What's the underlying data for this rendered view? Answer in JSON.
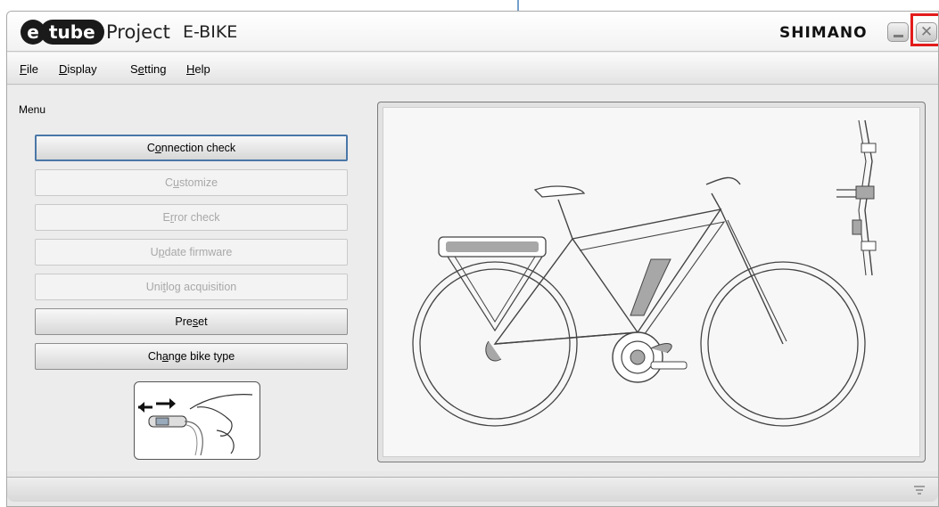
{
  "titlebar": {
    "logo_e": "e",
    "logo_tube": "tube",
    "app_name": "Project",
    "app_mode": "E-BIKE",
    "brand": "SHIMANO",
    "close_glyph": "✕"
  },
  "menubar": {
    "items": [
      {
        "mnemonic": "F",
        "rest": "ile"
      },
      {
        "mnemonic": "D",
        "rest": "isplay"
      },
      {
        "pre": "S",
        "mnemonic": "e",
        "rest": "tting"
      },
      {
        "mnemonic": "H",
        "rest": "elp"
      }
    ]
  },
  "menu": {
    "label": "Menu",
    "buttons": [
      {
        "pre": "C",
        "mnemonic": "o",
        "rest": "nnection check",
        "state": "enabled-active"
      },
      {
        "pre": "C",
        "mnemonic": "u",
        "rest": "stomize",
        "state": "disabled"
      },
      {
        "pre": "E",
        "mnemonic": "r",
        "rest": "ror check",
        "state": "disabled"
      },
      {
        "pre": "U",
        "mnemonic": "p",
        "rest": "date firmware",
        "state": "disabled"
      },
      {
        "pre": "Uni",
        "mnemonic": "t",
        "rest": " log acquisition",
        "state": "disabled"
      },
      {
        "pre": "Pre",
        "mnemonic": "s",
        "rest": "et",
        "state": "enabled"
      },
      {
        "pre": "Ch",
        "mnemonic": "a",
        "rest": "nge bike type",
        "state": "enabled"
      }
    ]
  },
  "colors": {
    "highlight": "#e31b1b",
    "annotation_arrow": "#2b6cb0",
    "active_border": "#4a77a8"
  },
  "icons": {
    "close": "close-icon",
    "minimize": "minimize-icon",
    "status": "resize-grip-icon",
    "thumbnail": "shifter-switch-thumbnail",
    "preview": "e-bike-diagram"
  }
}
